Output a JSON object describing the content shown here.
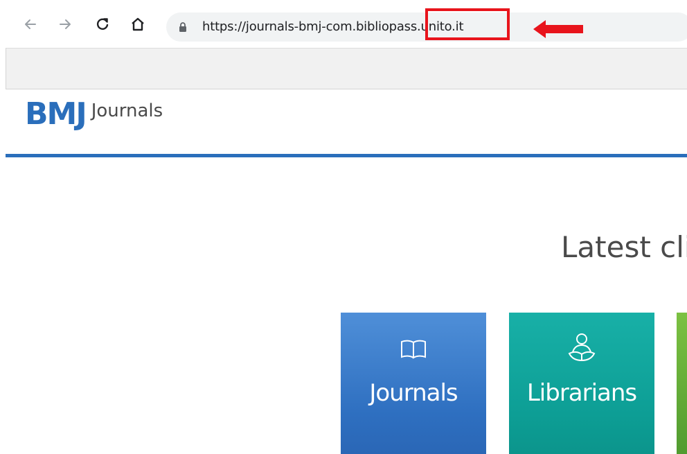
{
  "browser": {
    "url": "https://journals-bmj-com.bibliopass.unito.it"
  },
  "site": {
    "logo_mark": "BMJ",
    "logo_text": "Journals"
  },
  "main": {
    "heading": "Latest cli",
    "tiles": [
      {
        "label": "Journals",
        "icon": "open-book-icon",
        "color": "#3b7fcb"
      },
      {
        "label": "Librarians",
        "icon": "reader-icon",
        "color": "#11a79e"
      },
      {
        "label": "",
        "icon": "",
        "color": "#5faa36"
      }
    ]
  },
  "annotation": {
    "box_color": "#e8141c",
    "arrow_color": "#e8141c"
  }
}
